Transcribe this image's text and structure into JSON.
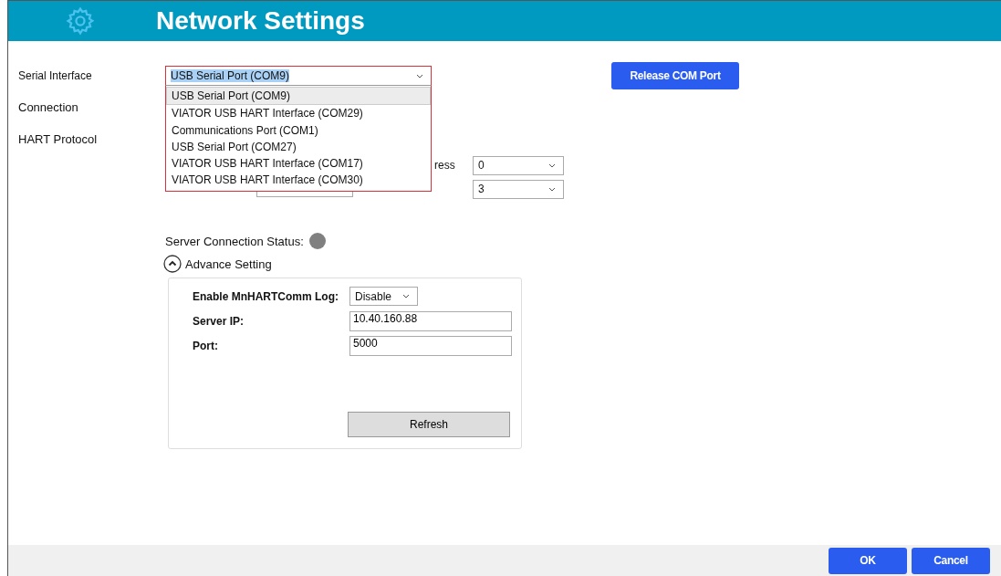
{
  "window": {
    "title": "Network Settings"
  },
  "serial_interface": {
    "label": "Serial Interface",
    "value": "USB Serial Port (COM9)",
    "expanded": true,
    "options": [
      {
        "label": "USB Serial Port (COM9)",
        "selected": true
      },
      {
        "label": "VIATOR USB HART Interface (COM29)",
        "selected": false
      },
      {
        "label": "Communications Port (COM1)",
        "selected": false
      },
      {
        "label": "USB Serial Port (COM27)",
        "selected": false
      },
      {
        "label": "VIATOR USB HART Interface (COM17)",
        "selected": false
      },
      {
        "label": "VIATOR USB HART Interface (COM30)",
        "selected": false
      }
    ]
  },
  "release_button": "Release COM Port",
  "sections": [
    {
      "label": "Connection"
    },
    {
      "label": "HART Protocol"
    }
  ],
  "hart_fields": [
    {
      "label": "ress",
      "value": "0"
    },
    {
      "value": "3"
    }
  ],
  "server_status": {
    "label": "Server Connection Status:",
    "color": "#808080"
  },
  "advance": {
    "label": "Advance Setting",
    "expanded": true,
    "log": {
      "label": "Enable MnHARTComm Log:",
      "value": "Disable"
    },
    "server_ip": {
      "label": "Server IP:",
      "value": "10.40.160.88"
    },
    "port": {
      "label": "Port:",
      "value": "5000"
    },
    "refresh": "Refresh"
  },
  "buttons": [
    {
      "label": "OK"
    },
    {
      "label": "Cancel"
    }
  ]
}
